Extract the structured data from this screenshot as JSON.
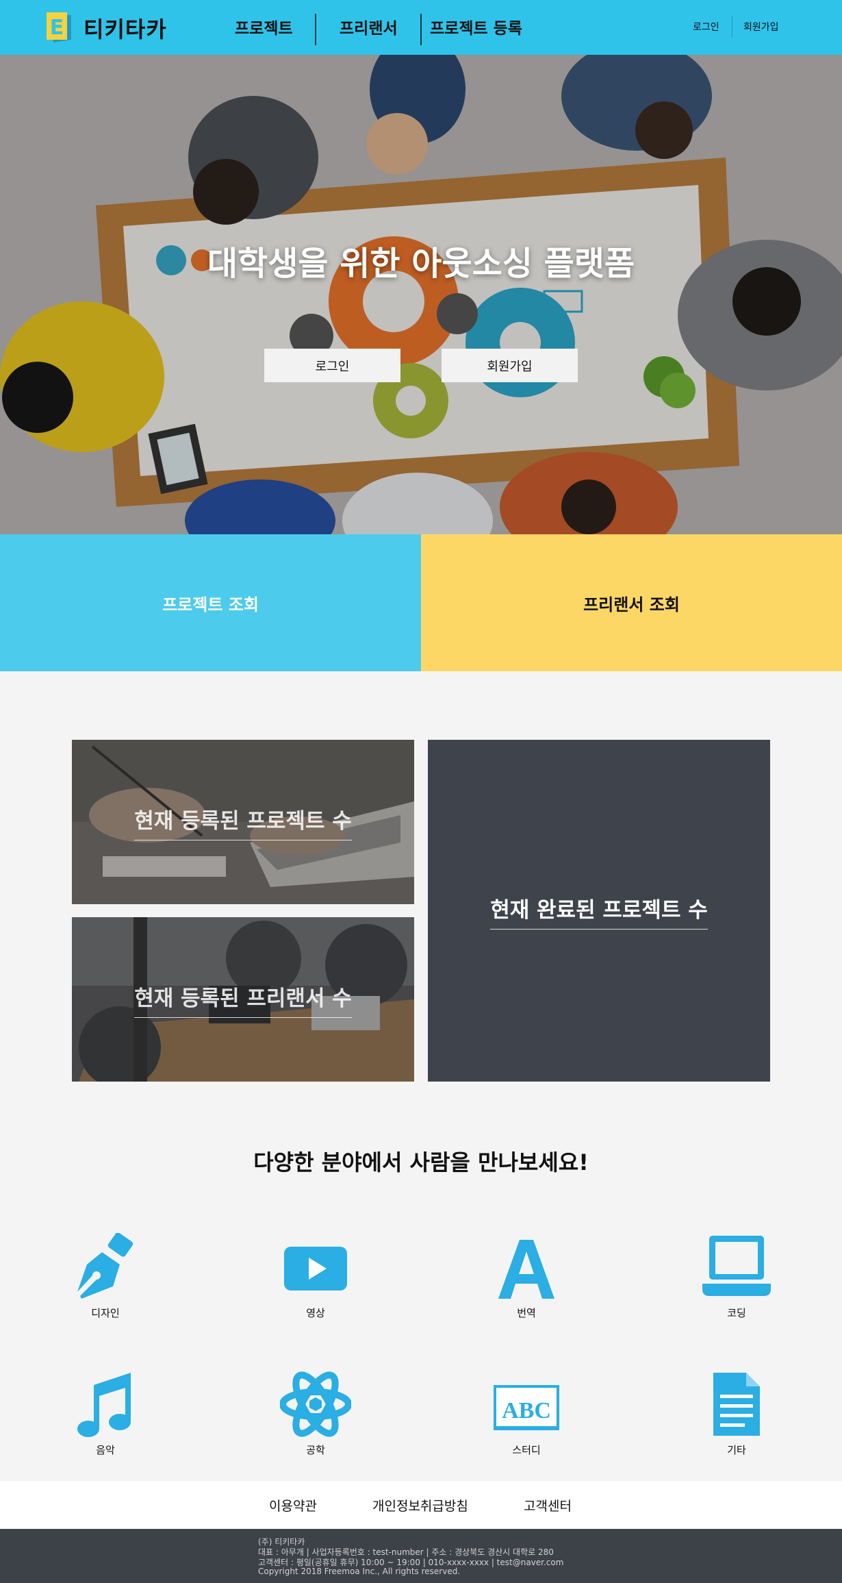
{
  "header": {
    "brand": "티키타카",
    "logo_letter": "E",
    "nav": [
      "프로젝트",
      "프리랜서",
      "프로젝트 등록"
    ],
    "login": "로그인",
    "signup": "회원가입"
  },
  "hero": {
    "title": "대학생을 위한 아웃소싱 플랫폼",
    "login_button": "로그인",
    "signup_button": "회원가입"
  },
  "lookup": {
    "projects": "프로젝트 조회",
    "freelancers": "프리랜서 조회"
  },
  "stats": {
    "registered_projects": "현재 등록된 프로젝트 수",
    "registered_freelancers": "현재 등록된 프리랜서 수",
    "completed_projects": "현재 완료된 프로젝트 수"
  },
  "categories": {
    "title": "다양한 분야에서 사람을 만나보세요!",
    "items": [
      {
        "label": "디자인",
        "icon": "pen-nib-icon"
      },
      {
        "label": "영상",
        "icon": "video-play-icon"
      },
      {
        "label": "번역",
        "icon": "letter-a-icon"
      },
      {
        "label": "코딩",
        "icon": "laptop-icon"
      },
      {
        "label": "음악",
        "icon": "music-note-icon"
      },
      {
        "label": "공학",
        "icon": "atom-icon"
      },
      {
        "label": "스터디",
        "icon": "abc-board-icon"
      },
      {
        "label": "기타",
        "icon": "document-icon"
      }
    ]
  },
  "footer": {
    "links": [
      "이용약관",
      "개인정보취급방침",
      "고객센터"
    ],
    "lines": [
      "(주) 티키타카",
      "대표 : 아무개 | 사업자등록번호 : test-number | 주소 : 경상북도 경산시 대학로 280",
      "고객센터 : 평일(공휴일 휴무) 10:00 ~ 19:00 | 010-xxxx-xxxx | test@naver.com",
      "Copyright 2018 Freemoa Inc., All rights reserved."
    ]
  },
  "colors": {
    "header_bg": "#2fc3ea",
    "lookup_left": "#4ccbec",
    "lookup_right": "#fdd765",
    "icon_blue": "#2aaee3",
    "dark_card": "#3f444c",
    "footer_bg": "#3d4148"
  }
}
